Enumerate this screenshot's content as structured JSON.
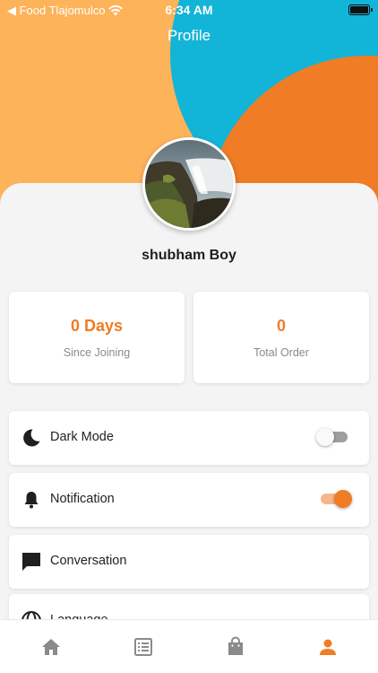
{
  "status_bar": {
    "carrier": "◀ Food Tlajomulco",
    "time": "6:34 AM",
    "wifi_icon": "wifi-icon",
    "battery_icon": "battery-icon"
  },
  "header": {
    "title": "Profile"
  },
  "profile": {
    "name": "shubham Boy",
    "avatar": "waterfall landscape photo"
  },
  "stats": [
    {
      "value": "0 Days",
      "label": "Since Joining"
    },
    {
      "value": "0",
      "label": "Total Order"
    }
  ],
  "settings": [
    {
      "label": "Dark Mode",
      "icon": "moon-icon",
      "toggle": false
    },
    {
      "label": "Notification",
      "icon": "bell-icon",
      "toggle": true
    },
    {
      "label": "Conversation",
      "icon": "chat-icon"
    },
    {
      "label": "Language",
      "icon": "globe-icon"
    }
  ],
  "bottom_nav": [
    {
      "icon": "home-icon",
      "active": false
    },
    {
      "icon": "orders-list-icon",
      "active": false
    },
    {
      "icon": "shopping-bag-icon",
      "active": false
    },
    {
      "icon": "profile-icon",
      "active": true
    }
  ],
  "colors": {
    "accent": "#f07c25",
    "hero_yellow": "#fdb35a",
    "hero_blue": "#12b4d8",
    "inactive_icon": "#8a8a8a"
  }
}
